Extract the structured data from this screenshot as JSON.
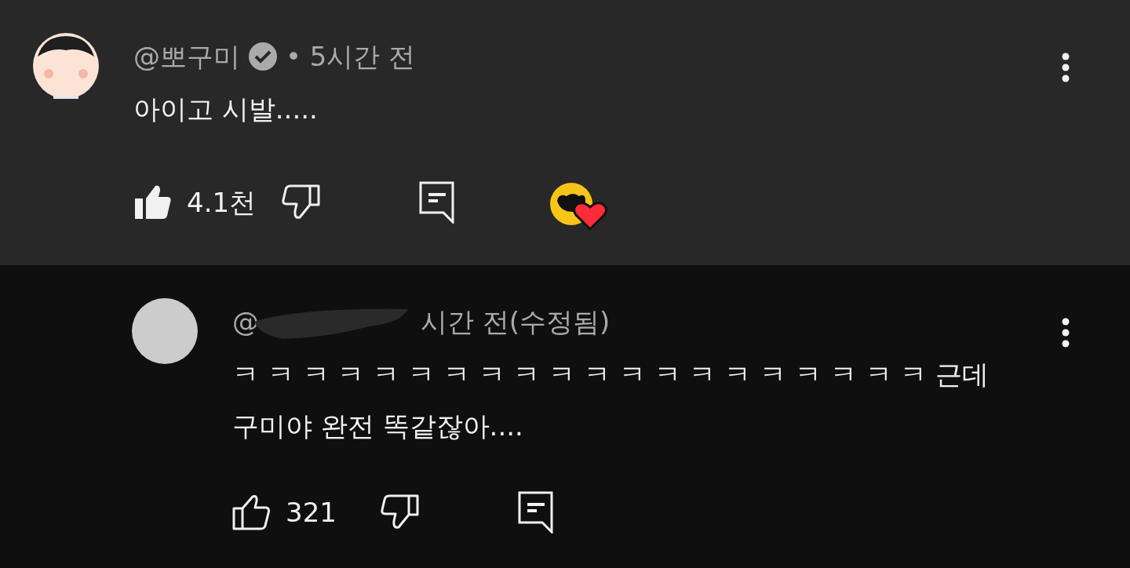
{
  "comments": [
    {
      "kind": "top",
      "author": "@뽀구미",
      "verified": true,
      "time": "• 5시간 전",
      "text": "아이고 시발.....",
      "likes": "4.1천",
      "liked": true,
      "creator_heart": true
    },
    {
      "kind": "reply",
      "author": "@",
      "redacted": true,
      "verified": false,
      "time": "시간 전(수정됨)",
      "text": "ㅋ ㅋ ㅋ ㅋ ㅋ ㅋ ㅋ ㅋ ㅋ ㅋ ㅋ ㅋ ㅋ ㅋ ㅋ ㅋ ㅋ ㅋ ㅋ ㅋ 근데 구미야 완전 똑같잖아....",
      "likes": "321",
      "liked": false,
      "creator_heart": false
    }
  ]
}
